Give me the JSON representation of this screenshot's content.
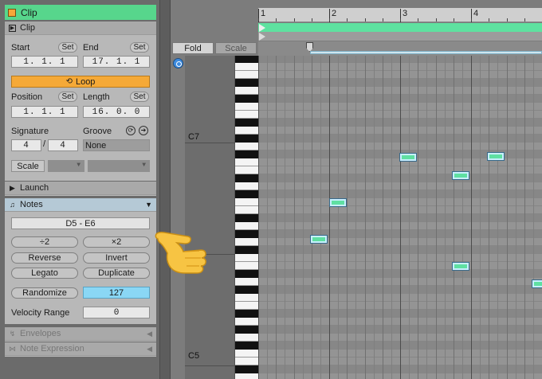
{
  "clip_header": {
    "title": "Clip"
  },
  "clip_section": {
    "title": "Clip",
    "start_label": "Start",
    "end_label": "End",
    "set_label": "Set",
    "start_value": "1.  1.  1",
    "end_value": "17.  1.  1",
    "loop_label": "Loop",
    "position_label": "Position",
    "length_label": "Length",
    "position_value": "1.  1.  1",
    "length_value": "16.  0.  0",
    "signature_label": "Signature",
    "groove_label": "Groove",
    "sig_numerator": "4",
    "sig_denominator": "4",
    "groove_value": "None",
    "scale_label": "Scale"
  },
  "launch_section": {
    "title": "Launch"
  },
  "notes_section": {
    "title": "Notes",
    "range": "D5 - E6",
    "halve_label": "÷2",
    "double_label": "×2",
    "reverse_label": "Reverse",
    "invert_label": "Invert",
    "legato_label": "Legato",
    "duplicate_label": "Duplicate",
    "randomize_label": "Randomize",
    "randomize_value": "127",
    "velocity_range_label": "Velocity Range",
    "velocity_range_value": "0"
  },
  "envelopes_section": {
    "title": "Envelopes"
  },
  "note_expression_section": {
    "title": "Note Expression"
  },
  "editor": {
    "fold_label": "Fold",
    "scale_label": "Scale",
    "bars": [
      "1",
      "2",
      "3",
      "4"
    ],
    "octave_labels": [
      "C7",
      "C5"
    ]
  },
  "colors": {
    "accent_green": "#57d68c",
    "loop_orange": "#f5a937",
    "value_blue": "#8ad7f5",
    "note_green": "#5fe0a2"
  },
  "icons": {
    "clip_color": "clip-color-square-icon",
    "pointing_hand": "pointing-hand-emoji-icon"
  }
}
